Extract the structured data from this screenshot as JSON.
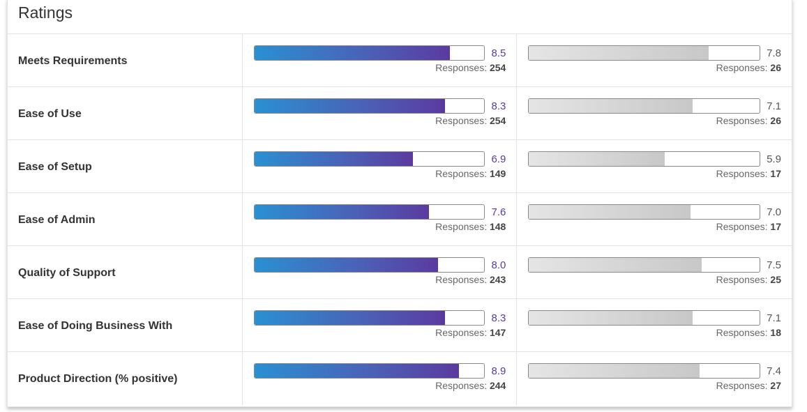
{
  "title": "Ratings",
  "responses_label": "Responses:",
  "colors": {
    "primary_start": "#2a90d2",
    "primary_end": "#5b3aa0",
    "secondary": "#c8c8c8"
  },
  "max_score": 10,
  "rows": [
    {
      "label": "Meets Requirements",
      "a": {
        "score": "8.5",
        "responses": "254"
      },
      "b": {
        "score": "7.8",
        "responses": "26"
      }
    },
    {
      "label": "Ease of Use",
      "a": {
        "score": "8.3",
        "responses": "254"
      },
      "b": {
        "score": "7.1",
        "responses": "26"
      }
    },
    {
      "label": "Ease of Setup",
      "a": {
        "score": "6.9",
        "responses": "149"
      },
      "b": {
        "score": "5.9",
        "responses": "17"
      }
    },
    {
      "label": "Ease of Admin",
      "a": {
        "score": "7.6",
        "responses": "148"
      },
      "b": {
        "score": "7.0",
        "responses": "17"
      }
    },
    {
      "label": "Quality of Support",
      "a": {
        "score": "8.0",
        "responses": "243"
      },
      "b": {
        "score": "7.5",
        "responses": "25"
      }
    },
    {
      "label": "Ease of Doing Business With",
      "a": {
        "score": "8.3",
        "responses": "147"
      },
      "b": {
        "score": "7.1",
        "responses": "18"
      }
    },
    {
      "label": "Product Direction (% positive)",
      "a": {
        "score": "8.9",
        "responses": "244"
      },
      "b": {
        "score": "7.4",
        "responses": "27"
      }
    }
  ]
}
